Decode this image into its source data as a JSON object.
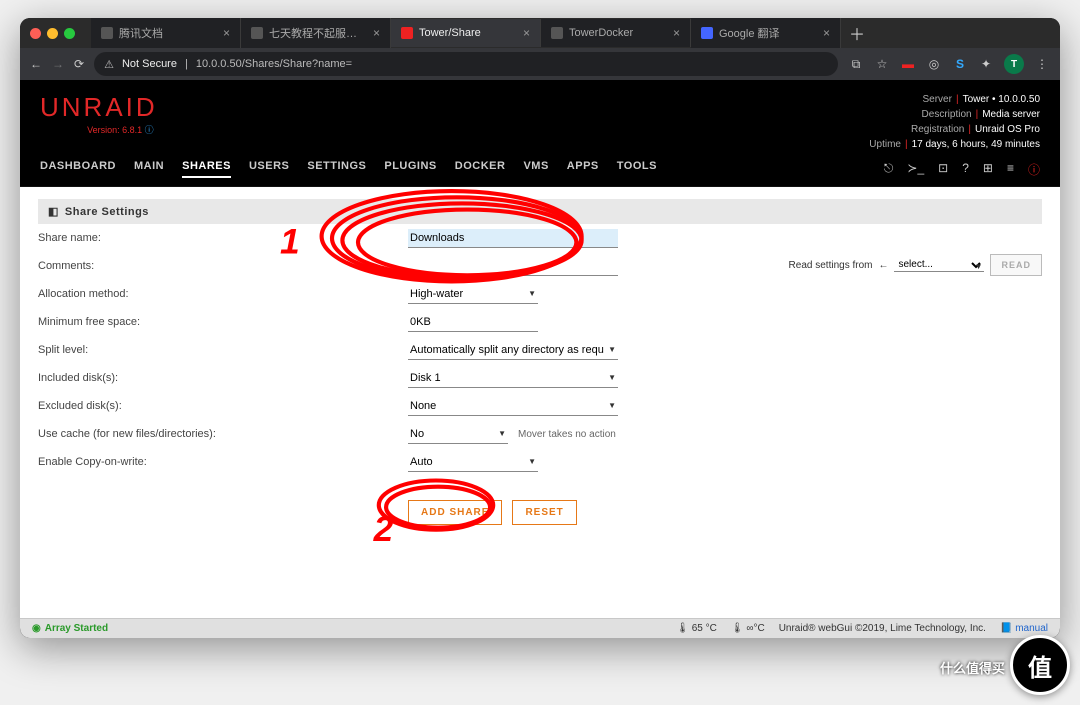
{
  "browser": {
    "tabs": [
      "腾讯文档",
      "七天教程不起服务怎么办？...",
      "Tower/Share",
      "TowerDocker",
      "Google 翻译"
    ],
    "activeTab": 2,
    "newTabGlyph": "＋",
    "nav": {
      "back": "←",
      "forward": "→",
      "reload": "⟳"
    },
    "notSecure": "Not Secure",
    "url": "10.0.0.50/Shares/Share?name=",
    "rightIcons": {
      "translate": "⧉",
      "star": "☆",
      "sync": "◎",
      "extS": "S",
      "puzzle": "✦",
      "avatar": "T",
      "menu": "⋮"
    }
  },
  "header": {
    "logo": "UNRAID",
    "version": "Version: 6.8.1",
    "sysinfo": {
      "Server": "Tower • 10.0.0.50",
      "Description": "Media server",
      "Registration": "Unraid OS Pro",
      "Uptime": "17 days, 6 hours, 49 minutes"
    }
  },
  "nav": {
    "items": [
      "DASHBOARD",
      "MAIN",
      "SHARES",
      "USERS",
      "SETTINGS",
      "PLUGINS",
      "DOCKER",
      "VMS",
      "APPS",
      "TOOLS"
    ],
    "active": "SHARES"
  },
  "panel": {
    "title": "Share Settings",
    "icon": "◧"
  },
  "form": {
    "rows": [
      {
        "label": "Share name:",
        "type": "text",
        "value": "Downloads",
        "highlight": true
      },
      {
        "label": "Comments:",
        "type": "text",
        "value": ""
      },
      {
        "label": "Allocation method:",
        "type": "select",
        "value": "High-water"
      },
      {
        "label": "Minimum free space:",
        "type": "text",
        "value": "0KB"
      },
      {
        "label": "Split level:",
        "type": "select",
        "value": "Automatically split any directory as required",
        "wide": true
      },
      {
        "label": "Included disk(s):",
        "type": "select",
        "value": "Disk 1",
        "wide": true
      },
      {
        "label": "Excluded disk(s):",
        "type": "select",
        "value": "None",
        "wide": true
      },
      {
        "label": "Use cache (for new files/directories):",
        "type": "select",
        "value": "No",
        "hint": "Mover takes no action"
      },
      {
        "label": "Enable Copy-on-write:",
        "type": "select",
        "value": "Auto"
      }
    ],
    "buttons": {
      "add": "ADD SHARE",
      "reset": "RESET"
    },
    "readFrom": {
      "label": "Read settings from",
      "arrow": "←",
      "placeholder": "select...",
      "button": "READ"
    }
  },
  "footer": {
    "status": "Array Started",
    "statusIcon": "◉",
    "temp1": "65 °C",
    "thermoIcon": "🌡",
    "temp2": "∞°C",
    "copyright": "Unraid® webGui ©2019, Lime Technology, Inc.",
    "manualIcon": "📘",
    "manual": "manual"
  },
  "annotations": {
    "one": "1",
    "two": "2"
  },
  "watermark": {
    "glyph": "值",
    "text": "什么值得买"
  }
}
